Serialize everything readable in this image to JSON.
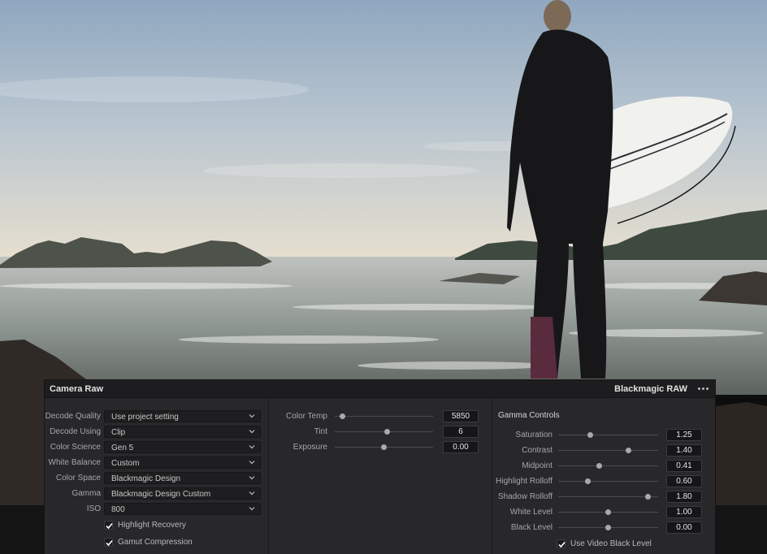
{
  "panel": {
    "title": "Camera Raw",
    "brand": "Blackmagic RAW",
    "more_icon": "more-horizontal-icon"
  },
  "decode_settings": [
    {
      "label": "Decode Quality",
      "value": "Use project setting"
    },
    {
      "label": "Decode Using",
      "value": "Clip"
    },
    {
      "label": "Color Science",
      "value": "Gen 5"
    },
    {
      "label": "White Balance",
      "value": "Custom"
    },
    {
      "label": "Color Space",
      "value": "Blackmagic Design"
    },
    {
      "label": "Gamma",
      "value": "Blackmagic Design Custom"
    },
    {
      "label": "ISO",
      "value": "800"
    }
  ],
  "decode_checkboxes": [
    {
      "label": "Highlight Recovery",
      "checked": true
    },
    {
      "label": "Gamut Compression",
      "checked": true
    }
  ],
  "image_controls": [
    {
      "label": "Color Temp",
      "value": "5850",
      "slider_fraction": 0.08
    },
    {
      "label": "Tint",
      "value": "6",
      "slider_fraction": 0.53
    },
    {
      "label": "Exposure",
      "value": "0.00",
      "slider_fraction": 0.5
    }
  ],
  "gamma_controls": {
    "title": "Gamma Controls",
    "items": [
      {
        "label": "Saturation",
        "value": "1.25",
        "slider_fraction": 0.32
      },
      {
        "label": "Contrast",
        "value": "1.40",
        "slider_fraction": 0.7
      },
      {
        "label": "Midpoint",
        "value": "0.41",
        "slider_fraction": 0.41
      },
      {
        "label": "Highlight Rolloff",
        "value": "0.60",
        "slider_fraction": 0.3
      },
      {
        "label": "Shadow Rolloff",
        "value": "1.80",
        "slider_fraction": 0.9
      },
      {
        "label": "White Level",
        "value": "1.00",
        "slider_fraction": 0.5
      },
      {
        "label": "Black Level",
        "value": "0.00",
        "slider_fraction": 0.5
      }
    ],
    "checkbox": {
      "label": "Use Video Black Level",
      "checked": true
    }
  },
  "icons": {
    "dropdown": "chevron-down-icon",
    "check": "checkmark-icon"
  },
  "colors": {
    "panel_bg": "#28282b",
    "header_bg": "#1d1d1f",
    "field_bg": "#1e1e20",
    "accent_text": "#e2e2e2"
  }
}
